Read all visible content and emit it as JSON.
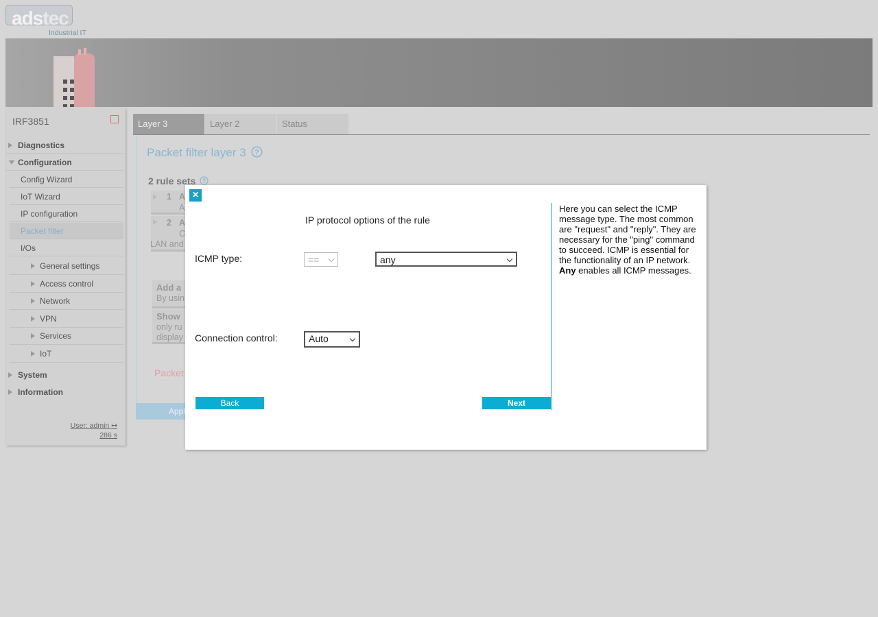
{
  "brand": {
    "logo_part1": "ads",
    "logo_part2": "tec",
    "tagline": "Industrial IT"
  },
  "sidebar": {
    "device_name": "IRF3851",
    "items": [
      {
        "label": "Diagnostics"
      },
      {
        "label": "Configuration"
      },
      {
        "label": "Config Wizard"
      },
      {
        "label": "IoT Wizard"
      },
      {
        "label": "IP configuration"
      },
      {
        "label": "Packet filter"
      },
      {
        "label": "I/Os"
      },
      {
        "label": "General settings"
      },
      {
        "label": "Access control"
      },
      {
        "label": "Network"
      },
      {
        "label": "VPN"
      },
      {
        "label": "Services"
      },
      {
        "label": "IoT"
      },
      {
        "label": "System"
      },
      {
        "label": "Information"
      }
    ],
    "user": "User: admin",
    "session_timer": "286 s"
  },
  "tabs": [
    {
      "label": "Layer 3"
    },
    {
      "label": "Layer 2"
    },
    {
      "label": "Status"
    }
  ],
  "main": {
    "title": "Packet filter layer 3",
    "rule_sets": "2 rule sets",
    "rows": [
      {
        "num": "1",
        "a": "A",
        "sub": "A"
      },
      {
        "num": "2",
        "a": "A",
        "sub": "C",
        "sub2": "LAN and"
      },
      {
        "t1": "Add a",
        "t2": "By usin"
      },
      {
        "t1": "Show",
        "t2": "only ru",
        "t3": "display"
      }
    ],
    "packet_label": "Packet",
    "apply_label": "Appl"
  },
  "dialog": {
    "close": "×",
    "title": "IP protocol options of the rule",
    "icmp_label": "ICMP type:",
    "operator_value": "==",
    "icmp_value": "any",
    "conn_label": "Connection control:",
    "conn_value": "Auto",
    "back": "Back",
    "next": "Next",
    "help_text": "Here you can select the ICMP message type. The most common are \"request\" and \"reply\". They are necessary for the \"ping\" command to succeed. ICMP is essential for the functionality of an IP network.",
    "help_bold": "Any",
    "help_tail": " enables all ICMP messages."
  }
}
